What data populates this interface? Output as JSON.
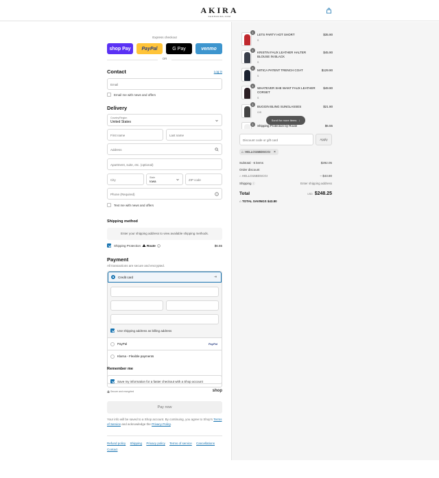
{
  "header": {
    "brand": "AKIRA",
    "brand_sub": "SHOPAKIRA.COM"
  },
  "express": {
    "label": "Express checkout",
    "shoppay": "shop Pay",
    "paypal": "PayPal",
    "gpay": "G Pay",
    "venmo": "venmo",
    "or": "OR"
  },
  "contact": {
    "heading": "Contact",
    "login": "Log in",
    "email_placeholder": "Email",
    "newsletter_label": "Email me with news and offers"
  },
  "delivery": {
    "heading": "Delivery",
    "country_label": "Country/Region",
    "country_value": "United States",
    "first_name": "First name",
    "last_name": "Last name",
    "address": "Address",
    "apartment": "Apartment, suite, etc. (optional)",
    "city": "City",
    "state_label": "State",
    "state_value": "Iowa",
    "zip": "ZIP code",
    "phone": "Phone (Required)",
    "sms_label": "Text me with news and offers"
  },
  "shipping_method": {
    "heading": "Shipping method",
    "note": "Enter your shipping address to view available shipping methods.",
    "protection_label": "Shipping Protection",
    "route": "Route",
    "protection_price": "$6.55"
  },
  "payment": {
    "heading": "Payment",
    "subtitle": "All transactions are secure and encrypted.",
    "credit_card": "Credit card",
    "billing_label": "Use shipping address as billing address",
    "paypal": "PayPal",
    "paypal_logo": "PayPal",
    "klarna": "Klarna - Flexible payments"
  },
  "remember": {
    "heading": "Remember me",
    "save_label": "Save my information for a faster checkout with a Shop account",
    "secure": "Secure and encrypted",
    "shop_logo": "shop"
  },
  "pay_now": "Pay now",
  "legal": {
    "text": "Your info will be saved to a Shop account. By continuing, you agree to Shop's",
    "terms": "Terms of Service",
    "and": "and acknowledge the",
    "privacy": "Privacy Policy"
  },
  "footer_links": [
    "Refund policy",
    "Shipping",
    "Privacy policy",
    "Terms of service",
    "Cancellations",
    "Contact"
  ],
  "cart": {
    "items": [
      {
        "name": "LETS PARTY HOT SHORT",
        "variant": "S",
        "price": "$35.90",
        "qty": "1",
        "color": "#c0282d"
      },
      {
        "name": "KRISTIN FAUX LEATHER HALTER BLOUSE IN BLACK",
        "variant": "S",
        "price": "$45.90",
        "qty": "1",
        "color": "#3a3f4a"
      },
      {
        "name": "MITICA PATENT TRENCH COAT",
        "variant": "S",
        "price": "$129.90",
        "qty": "1",
        "color": "#1c2230"
      },
      {
        "name": "WHATEVER SHE WANT FAUX LEATHER CORSET",
        "variant": "S",
        "price": "$49.90",
        "qty": "1",
        "color": "#2b1f24"
      },
      {
        "name": "BUGGIN BLING SUNGLASSES",
        "variant": "O/S",
        "price": "$21.90",
        "qty": "1",
        "color": "#444444"
      },
      {
        "name": "Shipping Protection by Route",
        "variant": "",
        "price": "$6.55",
        "qty": "1",
        "color": "#f0f0f0"
      }
    ],
    "scroll_hint": "Scroll for more items",
    "discount_placeholder": "Discount code or gift card",
    "apply": "Apply",
    "code_tag": "HELLO15BDSCGI",
    "subtotal_label": "Subtotal · 6 items",
    "subtotal": "$292.05",
    "order_discount_label": "Order discount",
    "discount_code": "HELLO15BDSCGI",
    "discount_amount": "− $43.80",
    "shipping_label": "Shipping",
    "shipping_value": "Enter shipping address",
    "total_label": "Total",
    "currency": "USD",
    "total": "$248.25",
    "savings_label": "TOTAL SAVINGS",
    "savings": "$43.80"
  },
  "colors": {
    "accent": "#1773b0",
    "shoppay": "#5a31f4",
    "paypal": "#ffc439",
    "venmo": "#3d95ce"
  }
}
